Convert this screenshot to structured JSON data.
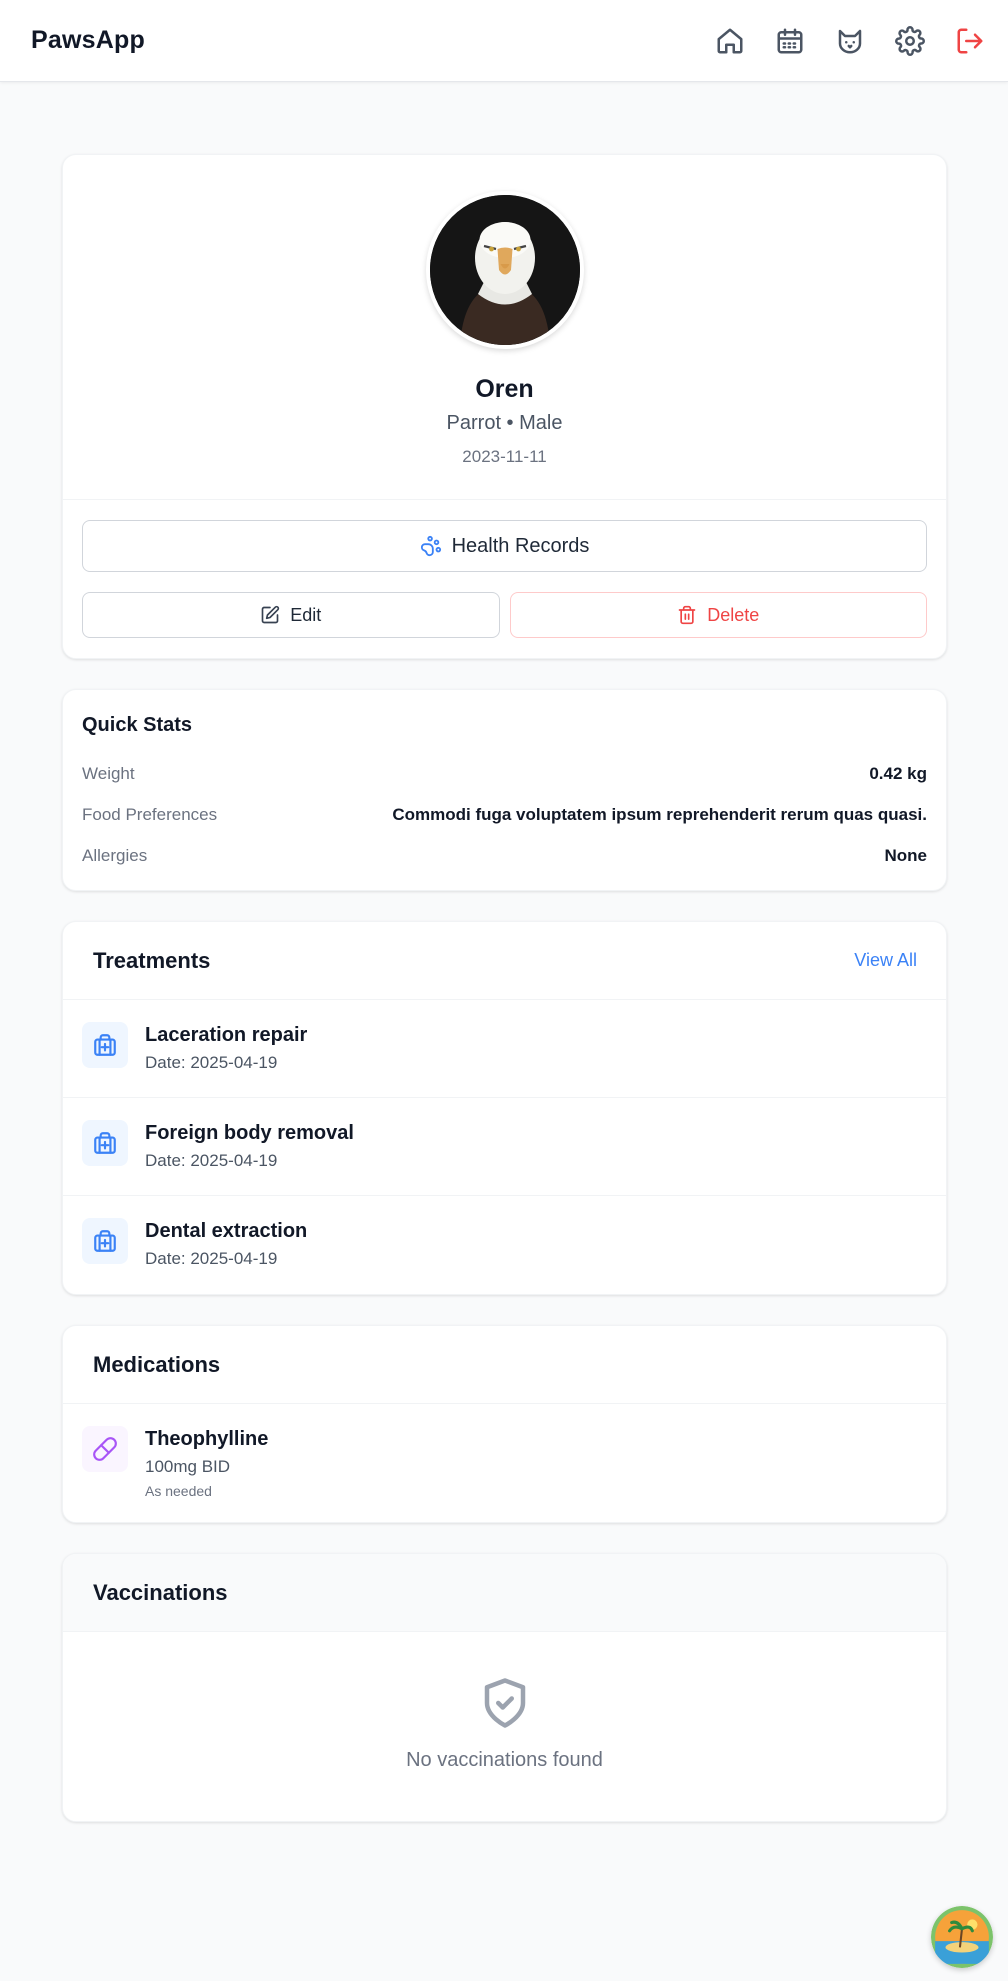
{
  "app": {
    "brand": "PawsApp"
  },
  "nav": [
    {
      "name": "home-icon"
    },
    {
      "name": "calendar-icon"
    },
    {
      "name": "cat-icon"
    },
    {
      "name": "settings-icon"
    },
    {
      "name": "logout-icon"
    }
  ],
  "profile": {
    "name": "Oren",
    "species_sex": "Parrot • Male",
    "date": "2023-11-11",
    "health_records_label": "Health Records",
    "edit_label": "Edit",
    "delete_label": "Delete"
  },
  "quick_stats": {
    "title": "Quick Stats",
    "rows": [
      {
        "label": "Weight",
        "value": "0.42 kg"
      },
      {
        "label": "Food Preferences",
        "value": "Commodi fuga voluptatem ipsum reprehenderit rerum quas quasi."
      },
      {
        "label": "Allergies",
        "value": "None"
      }
    ]
  },
  "treatments": {
    "title": "Treatments",
    "view_all": "View All",
    "items": [
      {
        "title": "Laceration repair",
        "date": "Date: 2025-04-19"
      },
      {
        "title": "Foreign body removal",
        "date": "Date: 2025-04-19"
      },
      {
        "title": "Dental extraction",
        "date": "Date: 2025-04-19"
      }
    ]
  },
  "medications": {
    "title": "Medications",
    "items": [
      {
        "title": "Theophylline",
        "dose": "100mg BID",
        "note": "As needed"
      }
    ]
  },
  "vaccinations": {
    "title": "Vaccinations",
    "empty_text": "No vaccinations found"
  },
  "colors": {
    "accent": "#3b82f6",
    "danger": "#ef4444",
    "medication": "#a855f7"
  }
}
